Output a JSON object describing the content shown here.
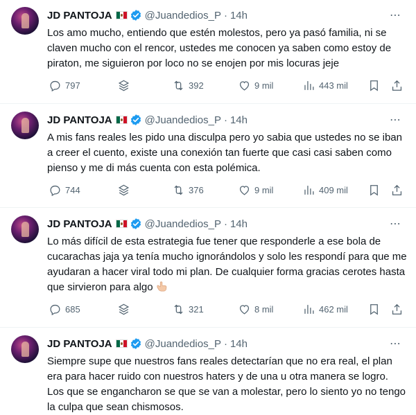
{
  "tweets": [
    {
      "author": "JD PANTOJA",
      "handle": "@Juandedios_P",
      "dot": "·",
      "time": "14h",
      "text": "Los amo mucho, entiendo que estén molestos, pero ya pasó familia, ni se claven mucho con el rencor,  ustedes me conocen ya saben como estoy de piraton,  me siguieron por loco no se enojen por mis locuras jeje",
      "replies": "797",
      "retweets": "392",
      "likes": "9 mil",
      "views": "443 mil"
    },
    {
      "author": "JD PANTOJA",
      "handle": "@Juandedios_P",
      "dot": "·",
      "time": "14h",
      "text": "A mis fans reales les pido una disculpa pero yo sabia que ustedes no se iban a creer el cuento, existe una conexión tan fuerte que casi casi saben como pienso y me di más cuenta con esta polémica.",
      "replies": "744",
      "retweets": "376",
      "likes": "9 mil",
      "views": "409 mil"
    },
    {
      "author": "JD PANTOJA",
      "handle": "@Juandedios_P",
      "dot": "·",
      "time": "14h",
      "text": "Lo más difícil de esta estrategia fue tener que responderle a ese bola de cucarachas jaja ya tenía mucho ignorándolos y solo les respondí para que me ayudaran a hacer viral todo mi plan. De cualquier forma gracias cerotes hasta que sirvieron para algo",
      "replies": "685",
      "retweets": "321",
      "likes": "8 mil",
      "views": "462 mil"
    },
    {
      "author": "JD PANTOJA",
      "handle": "@Juandedios_P",
      "dot": "·",
      "time": "14h",
      "text": "Siempre supe que nuestros fans reales detectarían que no era real, el plan era para hacer ruido con nuestros haters y de una u otra manera se logro. Los que se engancharon se que se van a molestar, pero lo siento yo no tengo la culpa que sean chismosos."
    }
  ],
  "icons": {
    "reply": "reply-icon",
    "stack": "stack-icon",
    "retweet": "retweet-icon",
    "like": "heart-icon",
    "views": "views-chart-icon",
    "bookmark": "bookmark-icon",
    "share": "share-icon",
    "more": "more-icon",
    "verified": "verified-badge-icon",
    "flag": "mexico-flag-icon",
    "emoji": "hand-emoji-icon"
  },
  "colors": {
    "verified": "#1d9bf0",
    "muted": "#536471",
    "text": "#0f1419",
    "divider": "#eff3f4"
  }
}
